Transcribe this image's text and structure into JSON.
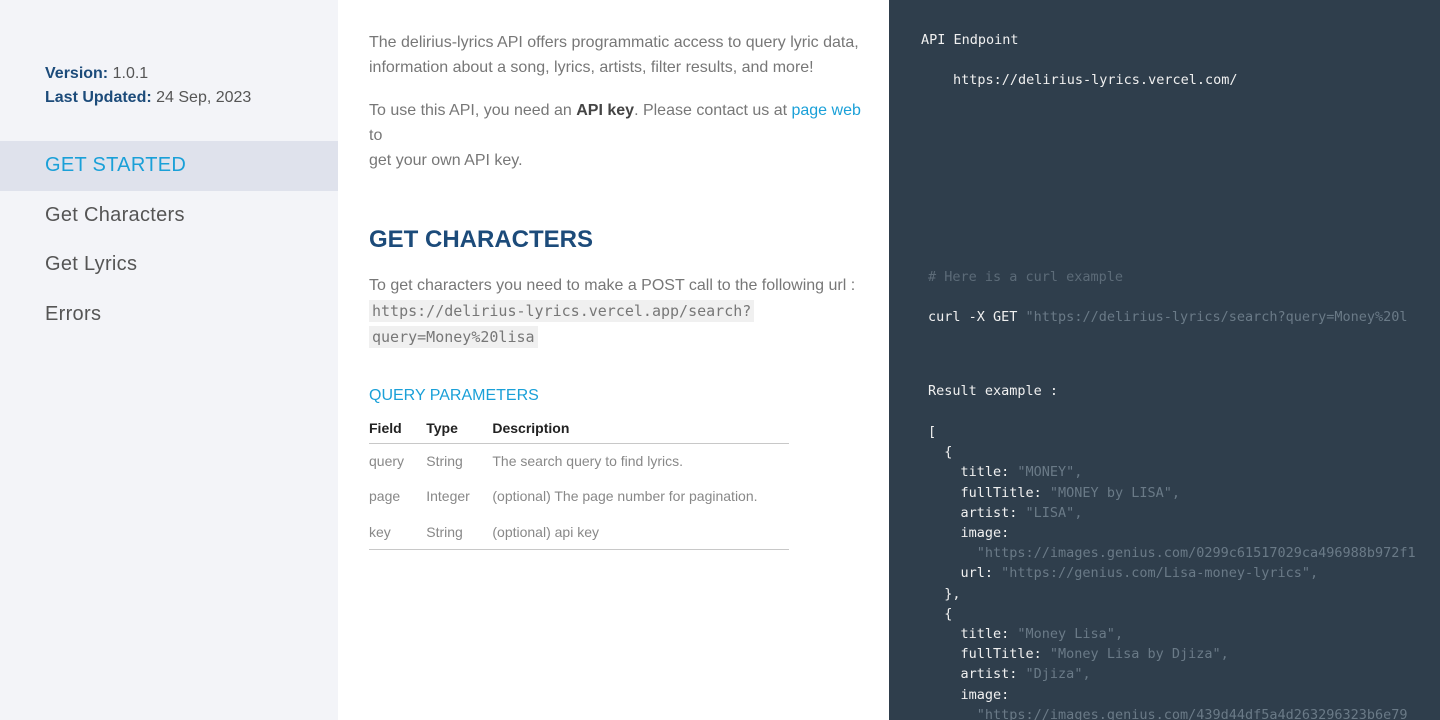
{
  "sidebar": {
    "version_label": "Version:",
    "version_value": "1.0.1",
    "updated_label": "Last Updated:",
    "updated_value": "24 Sep, 2023",
    "items": [
      {
        "label": "GET STARTED"
      },
      {
        "label": "Get Characters"
      },
      {
        "label": "Get Lyrics"
      },
      {
        "label": "Errors"
      }
    ]
  },
  "content": {
    "intro_line1": "The delirius-lyrics API offers programmatic access to query lyric data,",
    "intro_line2": "information about a song, lyrics, artists, filter results, and more!",
    "apikey_before": "To use this API, you need an ",
    "apikey_bold": "API key",
    "apikey_mid": ". Please contact us at ",
    "apikey_link": "page web",
    "apikey_after": " to",
    "apikey_line2": "get your own API key.",
    "section_title": "GET CHARACTERS",
    "section_desc": "To get characters you need to make a POST call to the following url :",
    "url_line1": "https://delirius-lyrics.vercel.app/search?",
    "url_line2": "query=Money%20lisa",
    "params_title": "QUERY PARAMETERS",
    "table": {
      "headers": [
        "Field",
        "Type",
        "Description"
      ],
      "rows": [
        [
          "query",
          "String",
          "The search query to find lyrics."
        ],
        [
          "page",
          "Integer",
          "(optional) The page number for pagination."
        ],
        [
          "key",
          "String",
          "(optional) api key"
        ]
      ]
    }
  },
  "code": {
    "endpoint_label": "API Endpoint",
    "endpoint_url": "https://delirius-lyrics.vercel.com/",
    "curl_comment": "# Here is a curl example",
    "curl_cmd": "curl -X GET ",
    "curl_url": "\"https://delirius-lyrics/search?query=Money%20l",
    "result_label": "Result example :",
    "json_lines": [
      {
        "k": "[",
        "v": ""
      },
      {
        "k": "  {",
        "v": ""
      },
      {
        "k": "    title: ",
        "v": "\"MONEY\","
      },
      {
        "k": "    fullTitle: ",
        "v": "\"MONEY by LISA\","
      },
      {
        "k": "    artist: ",
        "v": "\"LISA\","
      },
      {
        "k": "    image:",
        "v": ""
      },
      {
        "k": "      ",
        "v": "\"https://images.genius.com/0299c61517029ca496988b972f1"
      },
      {
        "k": "    url: ",
        "v": "\"https://genius.com/Lisa-money-lyrics\","
      },
      {
        "k": "  },",
        "v": ""
      },
      {
        "k": "  {",
        "v": ""
      },
      {
        "k": "    title: ",
        "v": "\"Money Lisa\","
      },
      {
        "k": "    fullTitle: ",
        "v": "\"Money Lisa by Djiza\","
      },
      {
        "k": "    artist: ",
        "v": "\"Djiza\","
      },
      {
        "k": "    image:",
        "v": ""
      },
      {
        "k": "      ",
        "v": "\"https://images.genius.com/439d44df5a4d263296323b6e79"
      }
    ]
  }
}
